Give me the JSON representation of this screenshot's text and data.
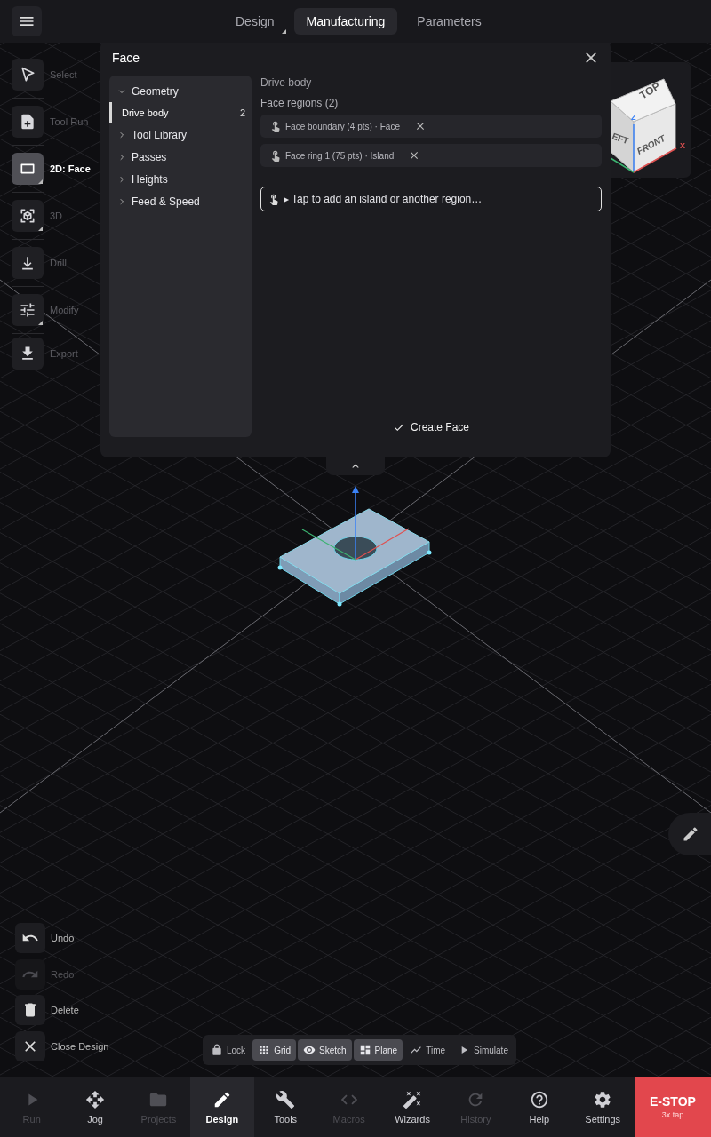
{
  "top_bar": {
    "tabs": [
      {
        "label": "Design",
        "selected": false,
        "submenu": true
      },
      {
        "label": "Manufacturing",
        "selected": true,
        "submenu": false
      },
      {
        "label": "Parameters",
        "selected": false,
        "submenu": false
      }
    ]
  },
  "tool_rail": [
    {
      "label": "Select",
      "selected": false,
      "submenu": false
    },
    {
      "label": "Tool Run",
      "selected": false,
      "submenu": false
    },
    {
      "label": "2D: Face",
      "selected": true,
      "submenu": true
    },
    {
      "label": "3D",
      "selected": false,
      "submenu": true
    },
    {
      "label": "Drill",
      "selected": false,
      "submenu": false
    },
    {
      "label": "Modify",
      "selected": false,
      "submenu": true
    },
    {
      "label": "Export",
      "selected": false,
      "submenu": false
    }
  ],
  "dialog": {
    "title": "Face",
    "tree": [
      {
        "label": "Geometry",
        "expanded": true,
        "children": [
          {
            "label": "Drive body",
            "count": "2",
            "selected": true
          }
        ]
      },
      {
        "label": "Tool Library",
        "expanded": false
      },
      {
        "label": "Passes",
        "expanded": false
      },
      {
        "label": "Heights",
        "expanded": false
      },
      {
        "label": "Feed & Speed",
        "expanded": false
      }
    ],
    "body_name": "Drive body",
    "regions_heading": "Face regions (2)",
    "regions": [
      {
        "label": "Face boundary (4 pts) · Face"
      },
      {
        "label": "Face ring 1 (75 pts) · Island"
      }
    ],
    "region_input": {
      "placeholder": "▸ Tap to add an island or another region…"
    },
    "create_button": "Create Face"
  },
  "view_cube": {
    "top": "TOP",
    "left": "EFT",
    "front": "FRONT",
    "z_axis": "Z",
    "x_axis": "X"
  },
  "actions": [
    {
      "label": "Undo",
      "disabled": false
    },
    {
      "label": "Redo",
      "disabled": true
    },
    {
      "label": "Delete",
      "disabled": false
    },
    {
      "label": "Close Design",
      "disabled": false
    }
  ],
  "view_toolbar": [
    {
      "label": "Lock",
      "on": false
    },
    {
      "label": "Grid",
      "on": true
    },
    {
      "label": "Sketch",
      "on": true
    },
    {
      "label": "Plane",
      "on": true
    },
    {
      "label": "Time",
      "on": false
    },
    {
      "label": "Simulate",
      "on": false
    }
  ],
  "bottom_nav": [
    {
      "label": "Run",
      "selected": false,
      "disabled": true
    },
    {
      "label": "Jog",
      "selected": false,
      "disabled": false
    },
    {
      "label": "Projects",
      "selected": false,
      "disabled": true
    },
    {
      "label": "Design",
      "selected": true,
      "disabled": false
    },
    {
      "label": "Tools",
      "selected": false,
      "disabled": false
    },
    {
      "label": "Macros",
      "selected": false,
      "disabled": true
    },
    {
      "label": "Wizards",
      "selected": false,
      "disabled": false
    },
    {
      "label": "History",
      "selected": false,
      "disabled": true
    },
    {
      "label": "Help",
      "selected": false,
      "disabled": false
    },
    {
      "label": "Settings",
      "selected": false,
      "disabled": false
    }
  ],
  "estop": {
    "label": "E-STOP",
    "hint": "3x tap"
  }
}
